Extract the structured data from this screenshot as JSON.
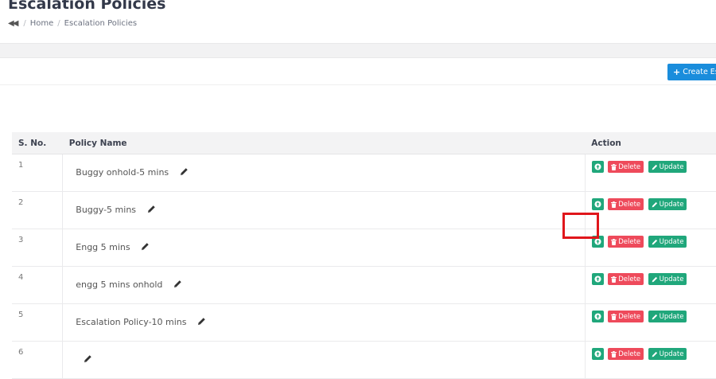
{
  "page": {
    "title": "Escalation Policies"
  },
  "breadcrumb": {
    "back_icon": "double-left-arrow-icon",
    "home": "Home",
    "separator": "/",
    "current": "Escalation Policies"
  },
  "toolbar": {
    "create_label": "Create Esc"
  },
  "table": {
    "headers": {
      "sno": "S. No.",
      "name": "Policy Name",
      "action": "Action"
    },
    "rows": [
      {
        "sno": "1",
        "name": "Buggy onhold-5 mins"
      },
      {
        "sno": "2",
        "name": "Buggy-5 mins"
      },
      {
        "sno": "3",
        "name": "Engg 5 mins"
      },
      {
        "sno": "4",
        "name": "engg 5 mins onhold"
      },
      {
        "sno": "5",
        "name": "Escalation Policy-10 mins"
      },
      {
        "sno": "6",
        "name": ""
      }
    ],
    "actions": {
      "delete": "Delete",
      "update": "Update"
    }
  },
  "colors": {
    "primary": "#1a8ddc",
    "success": "#20a77b",
    "danger": "#ee4a5b",
    "highlight": "#e0161b"
  }
}
